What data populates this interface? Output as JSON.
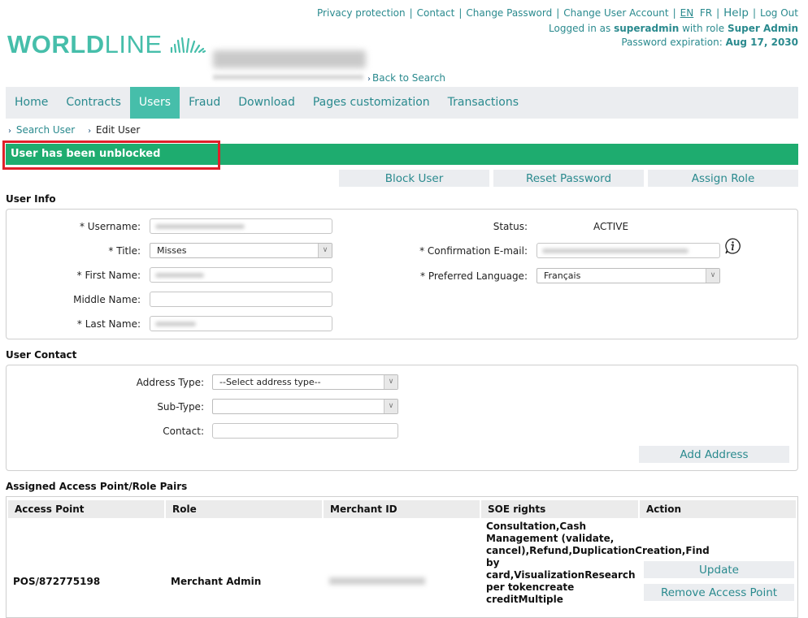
{
  "header": {
    "links": [
      "Privacy protection",
      "Contact",
      "Change Password",
      "Change User Account"
    ],
    "languages": [
      "EN",
      "FR"
    ],
    "active_language": "EN",
    "help": "Help",
    "logout": "Log Out",
    "logged_in_prefix": "Logged in as",
    "username": "superadmin",
    "role_prefix": "with role",
    "role": "Super Admin",
    "password_expiration_label": "Password expiration:",
    "password_expiration_value": "Aug 17, 2030",
    "logo_bold": "WORLD",
    "logo_light": "LINE",
    "back_to_search": "Back to Search",
    "accent_color": "#46beaa",
    "link_color": "#2a8a8e"
  },
  "nav": {
    "items": [
      "Home",
      "Contracts",
      "Users",
      "Fraud",
      "Download",
      "Pages customization",
      "Transactions"
    ],
    "active": "Users"
  },
  "breadcrumb": {
    "parent": "Search User",
    "current": "Edit User"
  },
  "banner": {
    "message": "User has been unblocked",
    "color": "#1eac6f"
  },
  "actions": {
    "block_user": "Block User",
    "reset_password": "Reset Password",
    "assign_role": "Assign Role"
  },
  "user_info": {
    "title": "User Info",
    "username_label": "* Username:",
    "title_label": "* Title:",
    "title_value": "Misses",
    "first_name_label": "* First Name:",
    "middle_name_label": "Middle Name:",
    "last_name_label": "* Last Name:",
    "status_label": "Status:",
    "status_value": "ACTIVE",
    "email_label": "* Confirmation E-mail:",
    "language_label": "* Preferred Language:",
    "language_value": "Français"
  },
  "user_contact": {
    "title": "User Contact",
    "address_type_label": "Address Type:",
    "address_type_value": "--Select address type--",
    "subtype_label": "Sub-Type:",
    "contact_label": "Contact:",
    "add_address": "Add Address"
  },
  "access_points": {
    "title": "Assigned Access Point/Role Pairs",
    "columns": [
      "Access Point",
      "Role",
      "Merchant ID",
      "SOE rights",
      "Action"
    ],
    "rows": [
      {
        "access_point": "POS/872775198",
        "role": "Merchant Admin",
        "soe_rights": "Consultation,Cash Management (validate, cancel),Refund,DuplicationCreation,Find by card,VisualizationResearch per tokencreate creditMultiple",
        "update": "Update",
        "remove": "Remove Access Point"
      }
    ]
  }
}
